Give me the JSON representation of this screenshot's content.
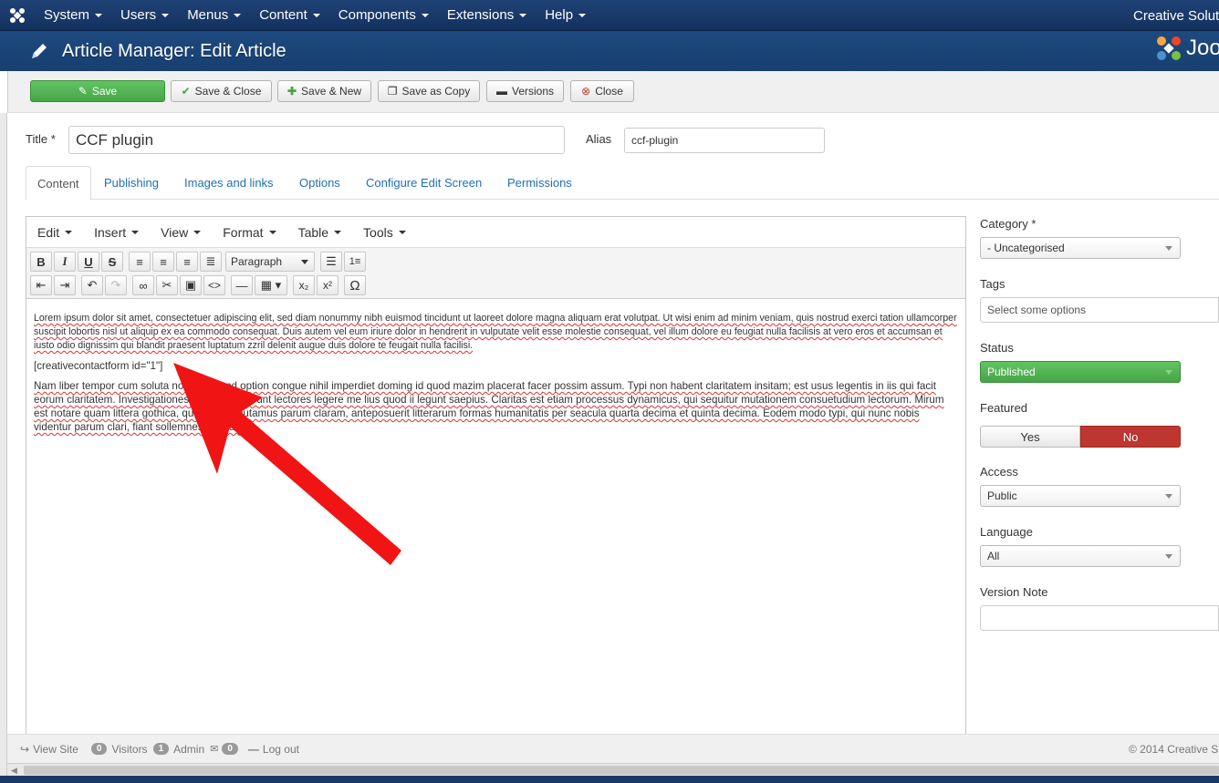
{
  "topnav": {
    "menu": [
      "System",
      "Users",
      "Menus",
      "Content",
      "Components",
      "Extensions",
      "Help"
    ],
    "site_title": "Creative Solut"
  },
  "header": {
    "title": "Article Manager: Edit Article",
    "brand": "Joo"
  },
  "toolbar": {
    "save": "Save",
    "save_close": "Save & Close",
    "save_new": "Save & New",
    "save_copy": "Save as Copy",
    "versions": "Versions",
    "close": "Close"
  },
  "form": {
    "title_label": "Title *",
    "title_value": "CCF plugin",
    "alias_label": "Alias",
    "alias_value": "ccf-plugin"
  },
  "tabs": [
    "Content",
    "Publishing",
    "Images and links",
    "Options",
    "Configure Edit Screen",
    "Permissions"
  ],
  "editor": {
    "menus": [
      "Edit",
      "Insert",
      "View",
      "Format",
      "Table",
      "Tools"
    ],
    "format_select": "Paragraph",
    "paragraph1": "Lorem ipsum dolor sit amet, consectetuer adipiscing elit, sed diam nonummy nibh euismod tincidunt ut laoreet dolore magna aliquam erat volutpat. Ut wisi enim ad minim veniam, quis nostrud exerci tation ullamcorper suscipit lobortis nisl ut aliquip ex ea commodo consequat. Duis autem vel eum iriure dolor in hendrerit in vulputate velit esse molestie consequat, vel illum dolore eu feugiat nulla facilisis at vero eros et accumsan et iusto odio dignissim qui blandit praesent luptatum zzril delenit augue duis dolore te feugait nulla facilisi.",
    "paragraph2": "[creativecontactform id=\"1\"]",
    "paragraph3": "Nam liber tempor cum soluta nobis eleifend option congue nihil imperdiet doming id quod mazim placerat facer possim assum. Typi non habent claritatem insitam; est usus legentis in iis qui facit eorum claritatem. Investigationes demonstraverunt lectores legere me lius quod ii legunt saepius. Claritas est etiam processus dynamicus, qui sequitur mutationem consuetudium lectorum. Mirum est notare quam littera gothica, quam nunc putamus parum claram, anteposuerit litterarum formas humanitatis per seacula quarta decima et quinta decima. Eodem modo typi, qui nunc nobis videntur parum clari, fiant sollemnes in futurum."
  },
  "sidebar": {
    "category_label": "Category *",
    "category_value": "- Uncategorised",
    "tags_label": "Tags",
    "tags_placeholder": "Select some options",
    "status_label": "Status",
    "status_value": "Published",
    "featured_label": "Featured",
    "featured_yes": "Yes",
    "featured_no": "No",
    "access_label": "Access",
    "access_value": "Public",
    "language_label": "Language",
    "language_value": "All",
    "version_note_label": "Version Note",
    "version_note_value": ""
  },
  "footer": {
    "view_site": "View Site",
    "visitors_count": "0",
    "visitors_label": "Visitors",
    "admin_count": "1",
    "admin_label": "Admin",
    "messages_count": "0",
    "logout": "Log out",
    "copyright": "© 2014 Creative S"
  },
  "colors": {
    "navy": "#1a3867",
    "green": "#46a546",
    "red": "#bd362f",
    "link": "#1f6fb5"
  }
}
